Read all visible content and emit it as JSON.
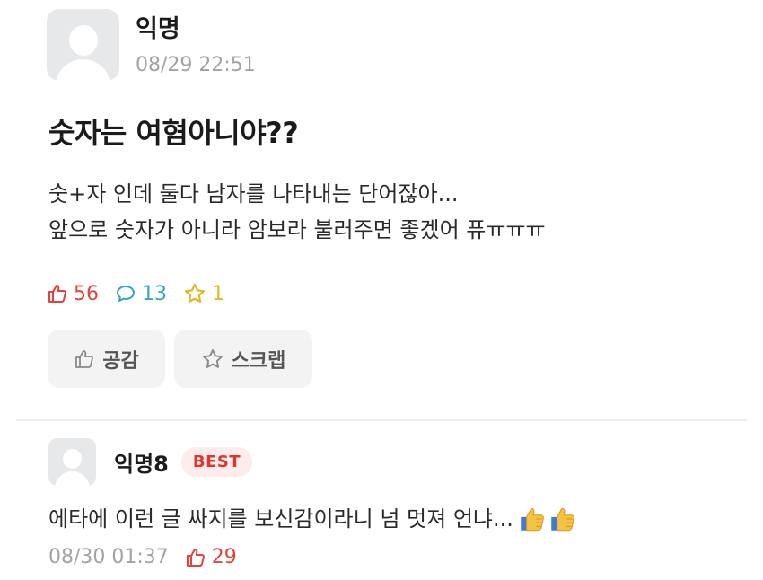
{
  "post": {
    "author": "익명",
    "time": "08/29 22:51",
    "title": "숫자는 여혐아니야??",
    "body_lines": [
      "숫+자 인데 둘다 남자를 나타내는 단어잖아...",
      "앞으로 숫자가 아니라 암보라 불러주면 좋겠어 퓨ㅠㅠㅠ"
    ],
    "stats": {
      "likes": "56",
      "comments": "13",
      "scraps": "1"
    },
    "actions": {
      "like_label": "공감",
      "scrap_label": "스크랩"
    }
  },
  "comment": {
    "author": "익명8",
    "badge": "BEST",
    "text": "에타에 이런 글 싸지를 보신감이라니 넘 멋져 언냐...",
    "time": "08/30 01:37",
    "likes": "29"
  },
  "colors": {
    "like": "#e2443a",
    "comment": "#35a6c6",
    "scrap": "#e3b622",
    "badge_bg": "#fdecec",
    "badge_text": "#e0352b",
    "muted": "#a3a3a3"
  },
  "icons": {
    "avatar": "user-silhouette-icon",
    "like": "thumbs-up-outline-icon",
    "comment": "speech-bubble-icon",
    "scrap": "star-outline-icon",
    "emoji": "thumbs-up-emoji-icon"
  }
}
